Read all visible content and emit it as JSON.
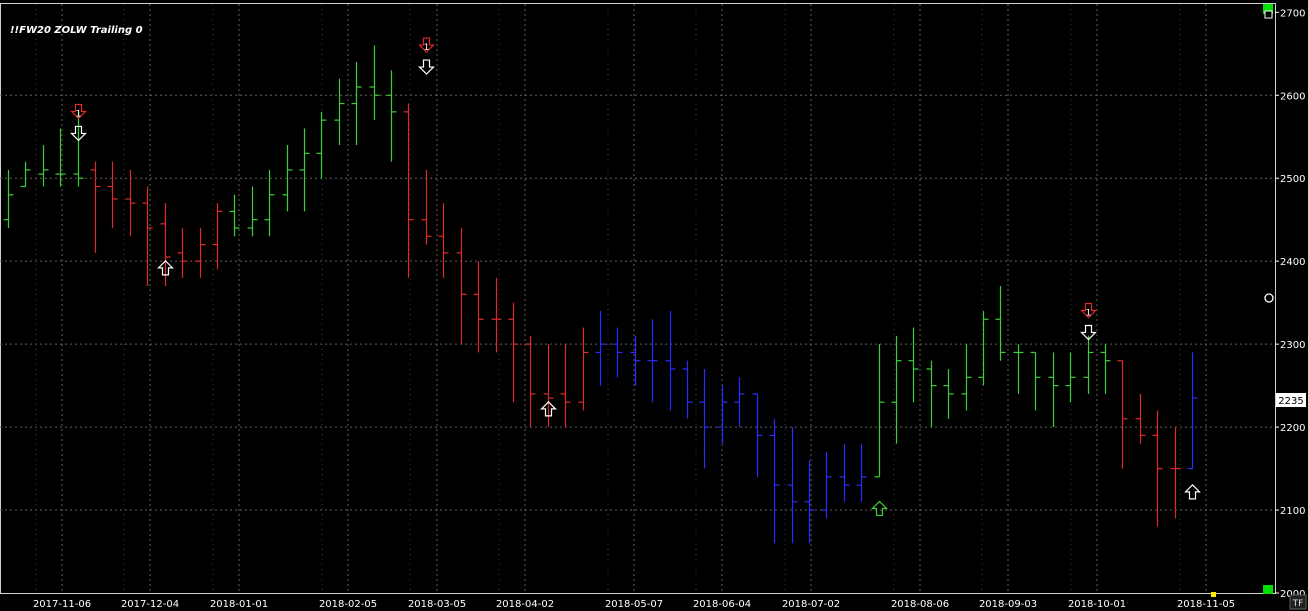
{
  "chart_data": {
    "type": "ohlc",
    "title": "!!FW20 ZOLW Trailing 0",
    "yticks": [
      2000,
      2100,
      2200,
      2300,
      2400,
      2500,
      2600,
      2700
    ],
    "ylim": [
      2000,
      2710
    ],
    "xticks": [
      "2017-11-06",
      "2017-12-04",
      "2018-01-01",
      "2018-02-05",
      "2018-03-05",
      "2018-04-02",
      "2018-05-07",
      "2018-06-04",
      "2018-07-02",
      "2018-08-06",
      "2018-09-03",
      "2018-10-01",
      "2018-11-05"
    ],
    "last_price": "2235",
    "footer_label": "TF",
    "colors": {
      "up": "#3ccf3c",
      "down": "#e02a2a",
      "neutral": "#2b2bff",
      "grid": "#606060",
      "signal_white": "#ffffff"
    },
    "bars": [
      {
        "color": "up",
        "o": 2450,
        "h": 2510,
        "l": 2440,
        "c": 2480
      },
      {
        "color": "up",
        "o": 2490,
        "h": 2520,
        "l": 2490,
        "c": 2510
      },
      {
        "color": "up",
        "o": 2505,
        "h": 2540,
        "l": 2490,
        "c": 2510
      },
      {
        "color": "up",
        "o": 2505,
        "h": 2560,
        "l": 2490,
        "c": 2505
      },
      {
        "color": "up",
        "o": 2505,
        "h": 2580,
        "l": 2490,
        "c": 2500
      },
      {
        "color": "down",
        "o": 2510,
        "h": 2520,
        "l": 2410,
        "c": 2490
      },
      {
        "color": "down",
        "o": 2490,
        "h": 2520,
        "l": 2440,
        "c": 2475
      },
      {
        "color": "down",
        "o": 2475,
        "h": 2510,
        "l": 2430,
        "c": 2470
      },
      {
        "color": "down",
        "o": 2470,
        "h": 2490,
        "l": 2370,
        "c": 2440
      },
      {
        "color": "down",
        "o": 2445,
        "h": 2470,
        "l": 2370,
        "c": 2405
      },
      {
        "color": "down",
        "o": 2410,
        "h": 2440,
        "l": 2380,
        "c": 2400
      },
      {
        "color": "down",
        "o": 2400,
        "h": 2440,
        "l": 2380,
        "c": 2420
      },
      {
        "color": "down",
        "o": 2420,
        "h": 2470,
        "l": 2390,
        "c": 2460
      },
      {
        "color": "up",
        "o": 2460,
        "h": 2480,
        "l": 2430,
        "c": 2440
      },
      {
        "color": "up",
        "o": 2440,
        "h": 2490,
        "l": 2430,
        "c": 2450
      },
      {
        "color": "up",
        "o": 2450,
        "h": 2510,
        "l": 2430,
        "c": 2480
      },
      {
        "color": "up",
        "o": 2480,
        "h": 2540,
        "l": 2460,
        "c": 2510
      },
      {
        "color": "up",
        "o": 2510,
        "h": 2560,
        "l": 2460,
        "c": 2530
      },
      {
        "color": "up",
        "o": 2530,
        "h": 2580,
        "l": 2500,
        "c": 2570
      },
      {
        "color": "up",
        "o": 2570,
        "h": 2620,
        "l": 2540,
        "c": 2590
      },
      {
        "color": "up",
        "o": 2590,
        "h": 2640,
        "l": 2540,
        "c": 2610
      },
      {
        "color": "up",
        "o": 2610,
        "h": 2660,
        "l": 2570,
        "c": 2600
      },
      {
        "color": "up",
        "o": 2600,
        "h": 2630,
        "l": 2520,
        "c": 2580
      },
      {
        "color": "down",
        "o": 2580,
        "h": 2590,
        "l": 2380,
        "c": 2450
      },
      {
        "color": "down",
        "o": 2450,
        "h": 2510,
        "l": 2420,
        "c": 2430
      },
      {
        "color": "down",
        "o": 2430,
        "h": 2470,
        "l": 2380,
        "c": 2410
      },
      {
        "color": "down",
        "o": 2410,
        "h": 2440,
        "l": 2300,
        "c": 2360
      },
      {
        "color": "down",
        "o": 2360,
        "h": 2400,
        "l": 2290,
        "c": 2330
      },
      {
        "color": "down",
        "o": 2330,
        "h": 2380,
        "l": 2290,
        "c": 2330
      },
      {
        "color": "down",
        "o": 2330,
        "h": 2350,
        "l": 2230,
        "c": 2300
      },
      {
        "color": "down",
        "o": 2300,
        "h": 2310,
        "l": 2200,
        "c": 2240
      },
      {
        "color": "down",
        "o": 2240,
        "h": 2300,
        "l": 2200,
        "c": 2235
      },
      {
        "color": "down",
        "o": 2240,
        "h": 2300,
        "l": 2200,
        "c": 2230
      },
      {
        "color": "down",
        "o": 2230,
        "h": 2320,
        "l": 2220,
        "c": 2290
      },
      {
        "color": "blue",
        "o": 2290,
        "h": 2340,
        "l": 2250,
        "c": 2300
      },
      {
        "color": "blue",
        "o": 2300,
        "h": 2320,
        "l": 2260,
        "c": 2290
      },
      {
        "color": "blue",
        "o": 2290,
        "h": 2310,
        "l": 2250,
        "c": 2280
      },
      {
        "color": "blue",
        "o": 2280,
        "h": 2330,
        "l": 2230,
        "c": 2280
      },
      {
        "color": "blue",
        "o": 2280,
        "h": 2340,
        "l": 2220,
        "c": 2270
      },
      {
        "color": "blue",
        "o": 2270,
        "h": 2280,
        "l": 2210,
        "c": 2230
      },
      {
        "color": "blue",
        "o": 2230,
        "h": 2270,
        "l": 2150,
        "c": 2200
      },
      {
        "color": "blue",
        "o": 2200,
        "h": 2250,
        "l": 2180,
        "c": 2230
      },
      {
        "color": "blue",
        "o": 2230,
        "h": 2260,
        "l": 2200,
        "c": 2240
      },
      {
        "color": "blue",
        "o": 2240,
        "h": 2240,
        "l": 2140,
        "c": 2190
      },
      {
        "color": "blue",
        "o": 2190,
        "h": 2210,
        "l": 2060,
        "c": 2130
      },
      {
        "color": "blue",
        "o": 2130,
        "h": 2200,
        "l": 2060,
        "c": 2110
      },
      {
        "color": "blue",
        "o": 2110,
        "h": 2160,
        "l": 2060,
        "c": 2100
      },
      {
        "color": "blue",
        "o": 2100,
        "h": 2170,
        "l": 2090,
        "c": 2140
      },
      {
        "color": "blue",
        "o": 2140,
        "h": 2180,
        "l": 2110,
        "c": 2130
      },
      {
        "color": "blue",
        "o": 2130,
        "h": 2180,
        "l": 2110,
        "c": 2140
      },
      {
        "color": "up",
        "o": 2140,
        "h": 2300,
        "l": 2140,
        "c": 2230
      },
      {
        "color": "up",
        "o": 2230,
        "h": 2310,
        "l": 2180,
        "c": 2280
      },
      {
        "color": "up",
        "o": 2280,
        "h": 2320,
        "l": 2230,
        "c": 2270
      },
      {
        "color": "up",
        "o": 2270,
        "h": 2280,
        "l": 2200,
        "c": 2250
      },
      {
        "color": "up",
        "o": 2250,
        "h": 2270,
        "l": 2210,
        "c": 2240
      },
      {
        "color": "up",
        "o": 2240,
        "h": 2300,
        "l": 2220,
        "c": 2260
      },
      {
        "color": "up",
        "o": 2260,
        "h": 2340,
        "l": 2250,
        "c": 2330
      },
      {
        "color": "up",
        "o": 2330,
        "h": 2370,
        "l": 2280,
        "c": 2290
      },
      {
        "color": "up",
        "o": 2290,
        "h": 2300,
        "l": 2240,
        "c": 2290
      },
      {
        "color": "up",
        "o": 2290,
        "h": 2290,
        "l": 2220,
        "c": 2260
      },
      {
        "color": "up",
        "o": 2260,
        "h": 2290,
        "l": 2200,
        "c": 2250
      },
      {
        "color": "up",
        "o": 2250,
        "h": 2290,
        "l": 2230,
        "c": 2260
      },
      {
        "color": "up",
        "o": 2260,
        "h": 2310,
        "l": 2240,
        "c": 2290
      },
      {
        "color": "up",
        "o": 2290,
        "h": 2300,
        "l": 2240,
        "c": 2280
      },
      {
        "color": "down",
        "o": 2280,
        "h": 2280,
        "l": 2150,
        "c": 2210
      },
      {
        "color": "down",
        "o": 2210,
        "h": 2240,
        "l": 2180,
        "c": 2190
      },
      {
        "color": "down",
        "o": 2190,
        "h": 2220,
        "l": 2080,
        "c": 2150
      },
      {
        "color": "down",
        "o": 2150,
        "h": 2200,
        "l": 2090,
        "c": 2150
      },
      {
        "color": "blue",
        "o": 2150,
        "h": 2290,
        "l": 2150,
        "c": 2235
      }
    ],
    "signals": [
      {
        "bar": 4,
        "dir": "down",
        "type": "entry",
        "price": 2560
      },
      {
        "bar": 24,
        "dir": "down",
        "type": "entry",
        "price": 2640
      },
      {
        "bar": 9,
        "dir": "up",
        "type": "exit",
        "price": 2410
      },
      {
        "bar": 31,
        "dir": "up",
        "type": "exit",
        "price": 2240
      },
      {
        "bar": 50,
        "dir": "up",
        "type": "exit",
        "price": 2120
      },
      {
        "bar": 62,
        "dir": "down",
        "type": "entry",
        "price": 2320
      },
      {
        "bar": 68,
        "dir": "up",
        "type": "exit",
        "price": 2140
      }
    ]
  }
}
